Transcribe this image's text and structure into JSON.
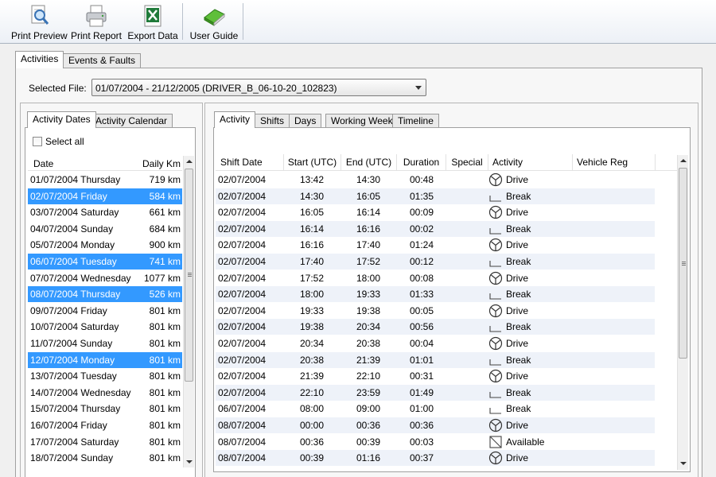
{
  "toolbar": {
    "print_preview": "Print Preview",
    "print_report": "Print Report",
    "export_data": "Export Data",
    "user_guide": "User Guide"
  },
  "main_tabs": [
    "Activities",
    "Events & Faults"
  ],
  "selected_file": {
    "label": "Selected File:",
    "value": "01/07/2004 - 21/12/2005 (DRIVER_B_06-10-20_102823)"
  },
  "left_tabs": [
    "Activity Dates",
    "Activity Calendar"
  ],
  "select_all": "Select all",
  "date_list": {
    "columns": [
      "Date",
      "Daily Km"
    ],
    "rows": [
      {
        "date": "01/07/2004 Thursday",
        "km": "719 km",
        "selected": false
      },
      {
        "date": "02/07/2004 Friday",
        "km": "584 km",
        "selected": true
      },
      {
        "date": "03/07/2004 Saturday",
        "km": "661 km",
        "selected": false
      },
      {
        "date": "04/07/2004 Sunday",
        "km": "684 km",
        "selected": false
      },
      {
        "date": "05/07/2004 Monday",
        "km": "900 km",
        "selected": false
      },
      {
        "date": "06/07/2004 Tuesday",
        "km": "741 km",
        "selected": true
      },
      {
        "date": "07/07/2004 Wednesday",
        "km": "1077 km",
        "selected": false
      },
      {
        "date": "08/07/2004 Thursday",
        "km": "526 km",
        "selected": true
      },
      {
        "date": "09/07/2004 Friday",
        "km": "801 km",
        "selected": false
      },
      {
        "date": "10/07/2004 Saturday",
        "km": "801 km",
        "selected": false
      },
      {
        "date": "11/07/2004 Sunday",
        "km": "801 km",
        "selected": false
      },
      {
        "date": "12/07/2004 Monday",
        "km": "801 km",
        "selected": true
      },
      {
        "date": "13/07/2004 Tuesday",
        "km": "801 km",
        "selected": false
      },
      {
        "date": "14/07/2004 Wednesday",
        "km": "801 km",
        "selected": false
      },
      {
        "date": "15/07/2004 Thursday",
        "km": "801 km",
        "selected": false
      },
      {
        "date": "16/07/2004 Friday",
        "km": "801 km",
        "selected": false
      },
      {
        "date": "17/07/2004 Saturday",
        "km": "801 km",
        "selected": false
      },
      {
        "date": "18/07/2004 Sunday",
        "km": "801 km",
        "selected": false
      }
    ]
  },
  "right_tabs": [
    "Activity",
    "Shifts",
    "Days",
    "Working Week",
    "Timeline"
  ],
  "activity_table": {
    "columns": [
      "Shift Date",
      "Start (UTC)",
      "End (UTC)",
      "Duration",
      "Special",
      "Activity",
      "Vehicle Reg"
    ],
    "rows": [
      {
        "date": "02/07/2004",
        "start": "13:42",
        "end": "14:30",
        "duration": "00:48",
        "activity": "Drive",
        "icon": "drive-icon"
      },
      {
        "date": "02/07/2004",
        "start": "14:30",
        "end": "16:05",
        "duration": "01:35",
        "activity": "Break",
        "icon": "break-icon"
      },
      {
        "date": "02/07/2004",
        "start": "16:05",
        "end": "16:14",
        "duration": "00:09",
        "activity": "Drive",
        "icon": "drive-icon"
      },
      {
        "date": "02/07/2004",
        "start": "16:14",
        "end": "16:16",
        "duration": "00:02",
        "activity": "Break",
        "icon": "break-icon"
      },
      {
        "date": "02/07/2004",
        "start": "16:16",
        "end": "17:40",
        "duration": "01:24",
        "activity": "Drive",
        "icon": "drive-icon"
      },
      {
        "date": "02/07/2004",
        "start": "17:40",
        "end": "17:52",
        "duration": "00:12",
        "activity": "Break",
        "icon": "break-icon"
      },
      {
        "date": "02/07/2004",
        "start": "17:52",
        "end": "18:00",
        "duration": "00:08",
        "activity": "Drive",
        "icon": "drive-icon"
      },
      {
        "date": "02/07/2004",
        "start": "18:00",
        "end": "19:33",
        "duration": "01:33",
        "activity": "Break",
        "icon": "break-icon"
      },
      {
        "date": "02/07/2004",
        "start": "19:33",
        "end": "19:38",
        "duration": "00:05",
        "activity": "Drive",
        "icon": "drive-icon"
      },
      {
        "date": "02/07/2004",
        "start": "19:38",
        "end": "20:34",
        "duration": "00:56",
        "activity": "Break",
        "icon": "break-icon"
      },
      {
        "date": "02/07/2004",
        "start": "20:34",
        "end": "20:38",
        "duration": "00:04",
        "activity": "Drive",
        "icon": "drive-icon"
      },
      {
        "date": "02/07/2004",
        "start": "20:38",
        "end": "21:39",
        "duration": "01:01",
        "activity": "Break",
        "icon": "break-icon"
      },
      {
        "date": "02/07/2004",
        "start": "21:39",
        "end": "22:10",
        "duration": "00:31",
        "activity": "Drive",
        "icon": "drive-icon"
      },
      {
        "date": "02/07/2004",
        "start": "22:10",
        "end": "23:59",
        "duration": "01:49",
        "activity": "Break",
        "icon": "break-icon"
      },
      {
        "date": "06/07/2004",
        "start": "08:00",
        "end": "09:00",
        "duration": "01:00",
        "activity": "Break",
        "icon": "break-icon"
      },
      {
        "date": "08/07/2004",
        "start": "00:00",
        "end": "00:36",
        "duration": "00:36",
        "activity": "Drive",
        "icon": "drive-icon"
      },
      {
        "date": "08/07/2004",
        "start": "00:36",
        "end": "00:39",
        "duration": "00:03",
        "activity": "Available",
        "icon": "available-icon"
      },
      {
        "date": "08/07/2004",
        "start": "00:39",
        "end": "01:16",
        "duration": "00:37",
        "activity": "Drive",
        "icon": "drive-icon"
      }
    ]
  },
  "colors": {
    "selection": "#3399ff",
    "alt_row": "#eef2f9"
  }
}
